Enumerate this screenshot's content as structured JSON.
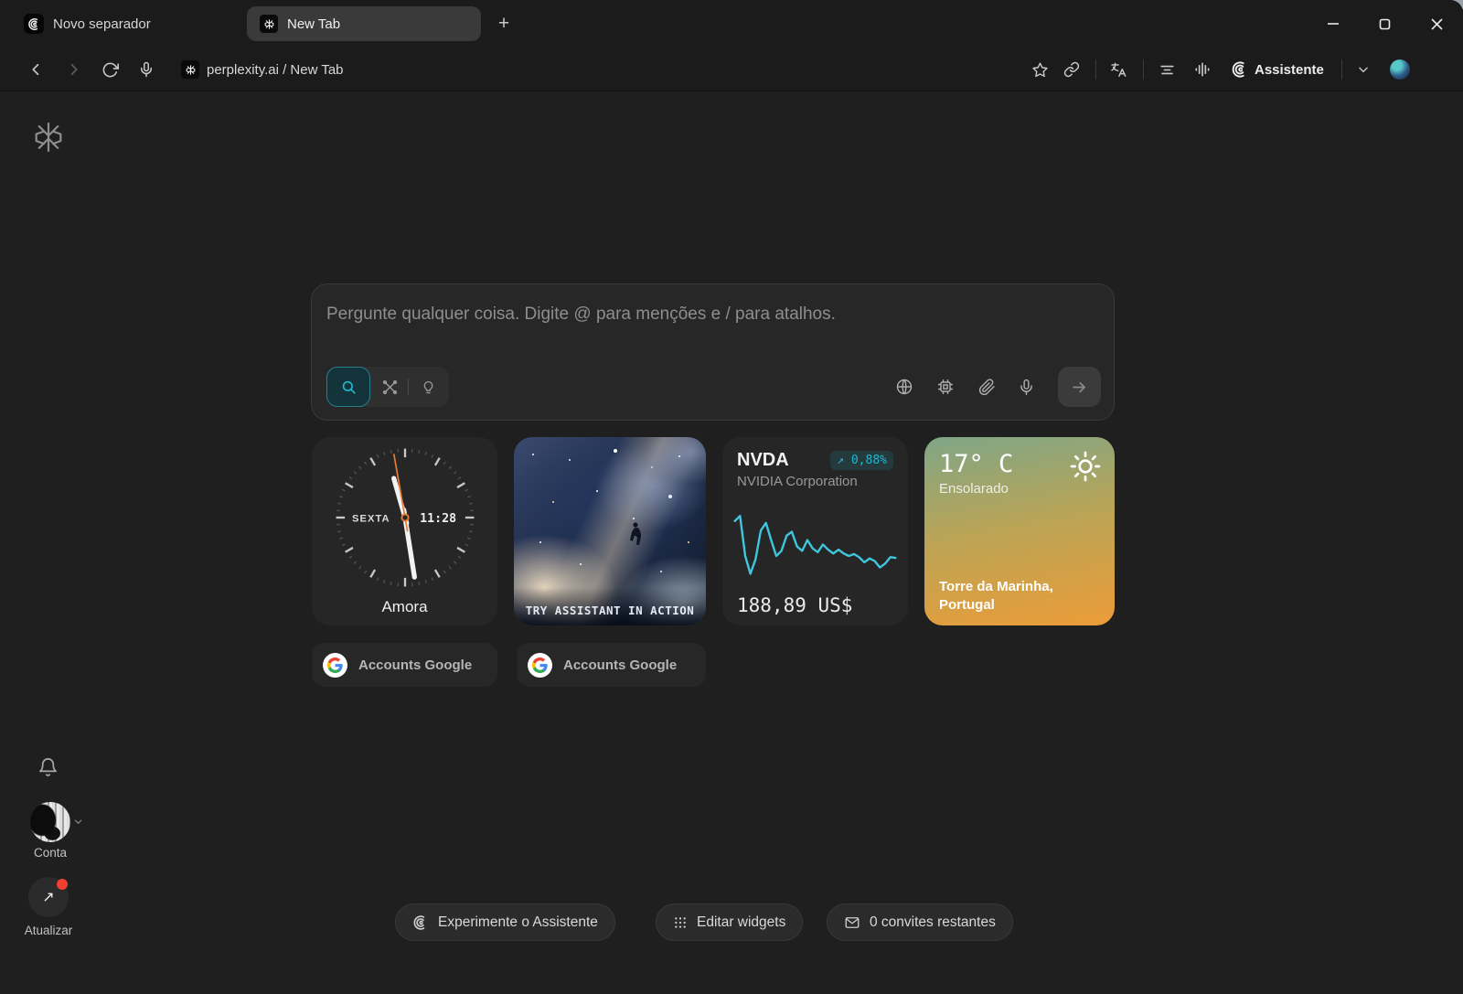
{
  "colors": {
    "accent_teal": "#20b8cd",
    "sparkline": "#3fc7de",
    "second_hand": "#e87b35",
    "red_dot": "#f23f31",
    "weather_top": "#7fa687",
    "weather_mid": "#bba455",
    "weather_bottom": "#ec9c38"
  },
  "tabstrip": {
    "left_tab_label": "Novo separador",
    "active_tab_label": "New Tab",
    "new_tab_button": "+"
  },
  "navbar": {
    "url": "perplexity.ai / New Tab",
    "assistant_label": "Assistente"
  },
  "search": {
    "placeholder": "Pergunte qualquer coisa. Digite @ para menções e / para atalhos."
  },
  "widgets": {
    "clock": {
      "day": "SEXTA",
      "time": "11:28",
      "label": "Amora",
      "hour_angle": 344,
      "minute_angle": 171,
      "second_angle": 350
    },
    "promo": {
      "caption": "TRY ASSISTANT IN ACTION"
    },
    "stock": {
      "symbol": "NVDA",
      "company": "NVIDIA Corporation",
      "change_badge": "↗ 0,88%",
      "price": "188,89 US$"
    },
    "weather": {
      "temperature": "17° C",
      "condition": "Ensolarado",
      "location_line1": "Torre da Marinha,",
      "location_line2": "Portugal"
    }
  },
  "shortcuts": {
    "first": "Accounts Google",
    "second": "Accounts Google"
  },
  "left_rail": {
    "account_label": "Conta",
    "update_label": "Atualizar"
  },
  "footer": {
    "try_assistant": "Experimente o Assistente",
    "edit_widgets": "Editar widgets",
    "invites": "0 convites restantes"
  },
  "chart_data": {
    "type": "line",
    "title": "NVDA price sparkline",
    "series": [
      {
        "name": "NVDA",
        "values": [
          85,
          93,
          30,
          2,
          25,
          70,
          82,
          55,
          30,
          38,
          62,
          68,
          45,
          38,
          55,
          42,
          36,
          48,
          40,
          34,
          40,
          34,
          30,
          33,
          28,
          20,
          26,
          22,
          12,
          18,
          28,
          27
        ]
      }
    ],
    "color": "#3fc7de",
    "grid": false,
    "axes": "hidden"
  }
}
